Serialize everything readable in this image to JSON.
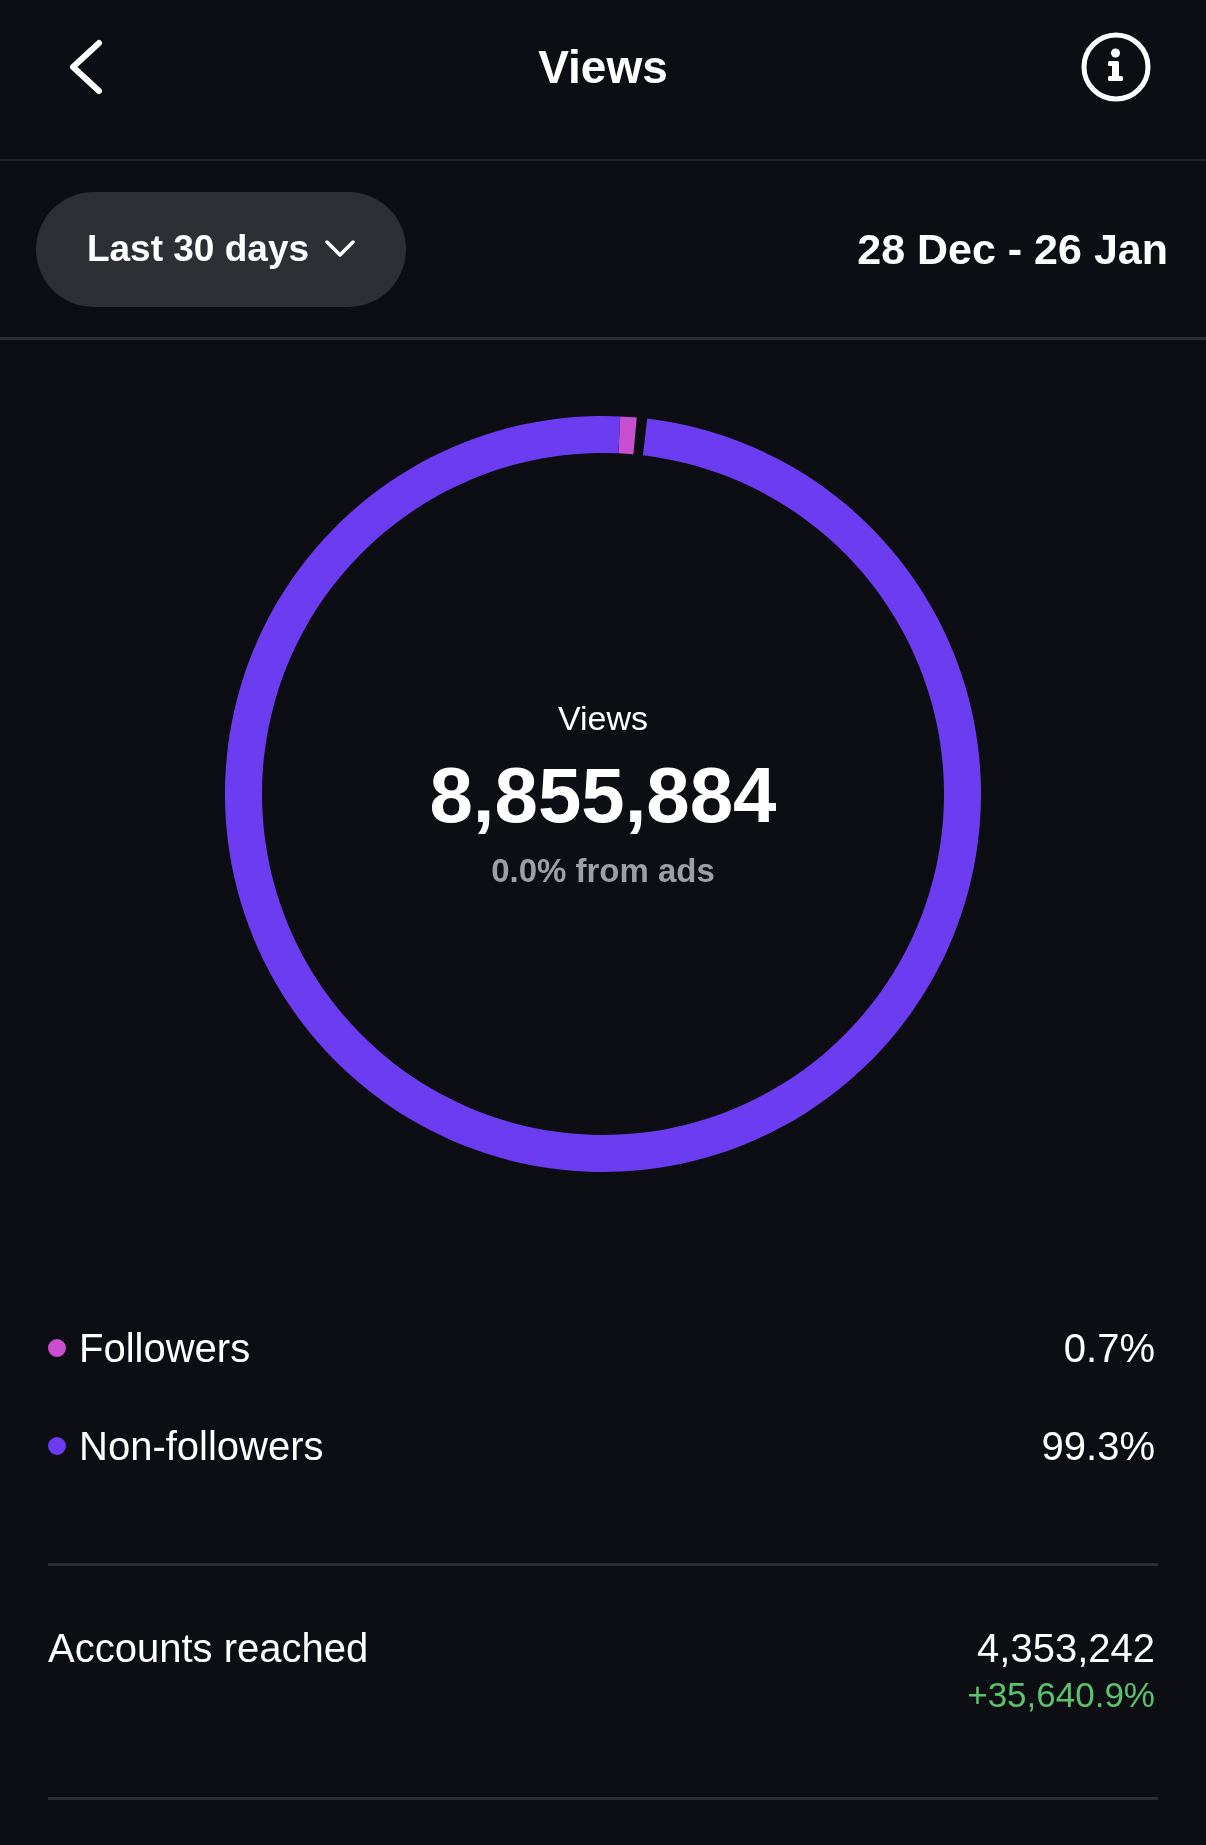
{
  "header": {
    "title": "Views"
  },
  "filter": {
    "period": "Last 30 days",
    "date_range": "28 Dec - 26 Jan"
  },
  "summary": {
    "total": "8,855,884",
    "ads_share": "0.0% from ads",
    "chart_data": {
      "type": "donut",
      "categories": [
        "Followers",
        "Non-followers"
      ],
      "series": [
        {
          "name": "Views",
          "values": [
            0.7,
            99.3
          ]
        }
      ]
    }
  },
  "audience": [
    {
      "value": "0.7%",
      "color": "#c84fcf"
    },
    {
      "value": "99.3%",
      "color": "#6c3cf0"
    }
  ],
  "metrics": [
    {
      "label": "Accounts reached",
      "value": "4,353,242",
      "change": "+35,640.9%"
    }
  ]
}
